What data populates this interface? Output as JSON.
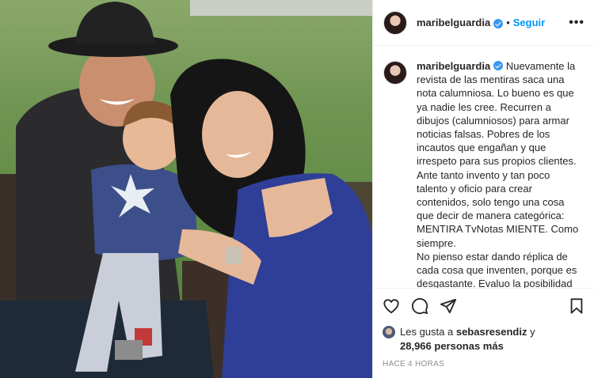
{
  "post": {
    "username": "maribelguardia",
    "follow_label": "Seguir",
    "separator": "•",
    "more_label": "•••",
    "caption_text": "Nuevamente la revista de las mentiras saca una nota calumniosa. Lo bueno es que ya nadie les cree. Recurren a dibujos (calumniosos) para armar noticias falsas. Pobres de los incautos que engañan y que irrespeto para sus propios clientes.\nAnte tanto invento y tan poco talento y oficio para crear contenidos, solo tengo una cosa que decir de manera categórica: MENTIRA TvNotas MIENTE. Como siempre.\nNo pienso estar dando réplica de cada cosa que inventen, porque es desgastante. Evaluo la posibilidad de demandar. Tampoco voy a caer en el juego de que me estén chantajeando con poner notas falsas a cambio de"
  },
  "likes": {
    "prefix": "Les gusta a",
    "liker": "sebasresendiz",
    "joiner": "y",
    "count_text": "28,966 personas más"
  },
  "timestamp": "HACE 4 HORAS",
  "icons": [
    "heart-icon",
    "comment-icon",
    "share-icon",
    "bookmark-icon",
    "verified-badge-icon",
    "more-options-icon"
  ],
  "colors": {
    "link_blue": "#0095f6",
    "verified_blue": "#3897f0",
    "muted_gray": "#8e8e8e"
  }
}
